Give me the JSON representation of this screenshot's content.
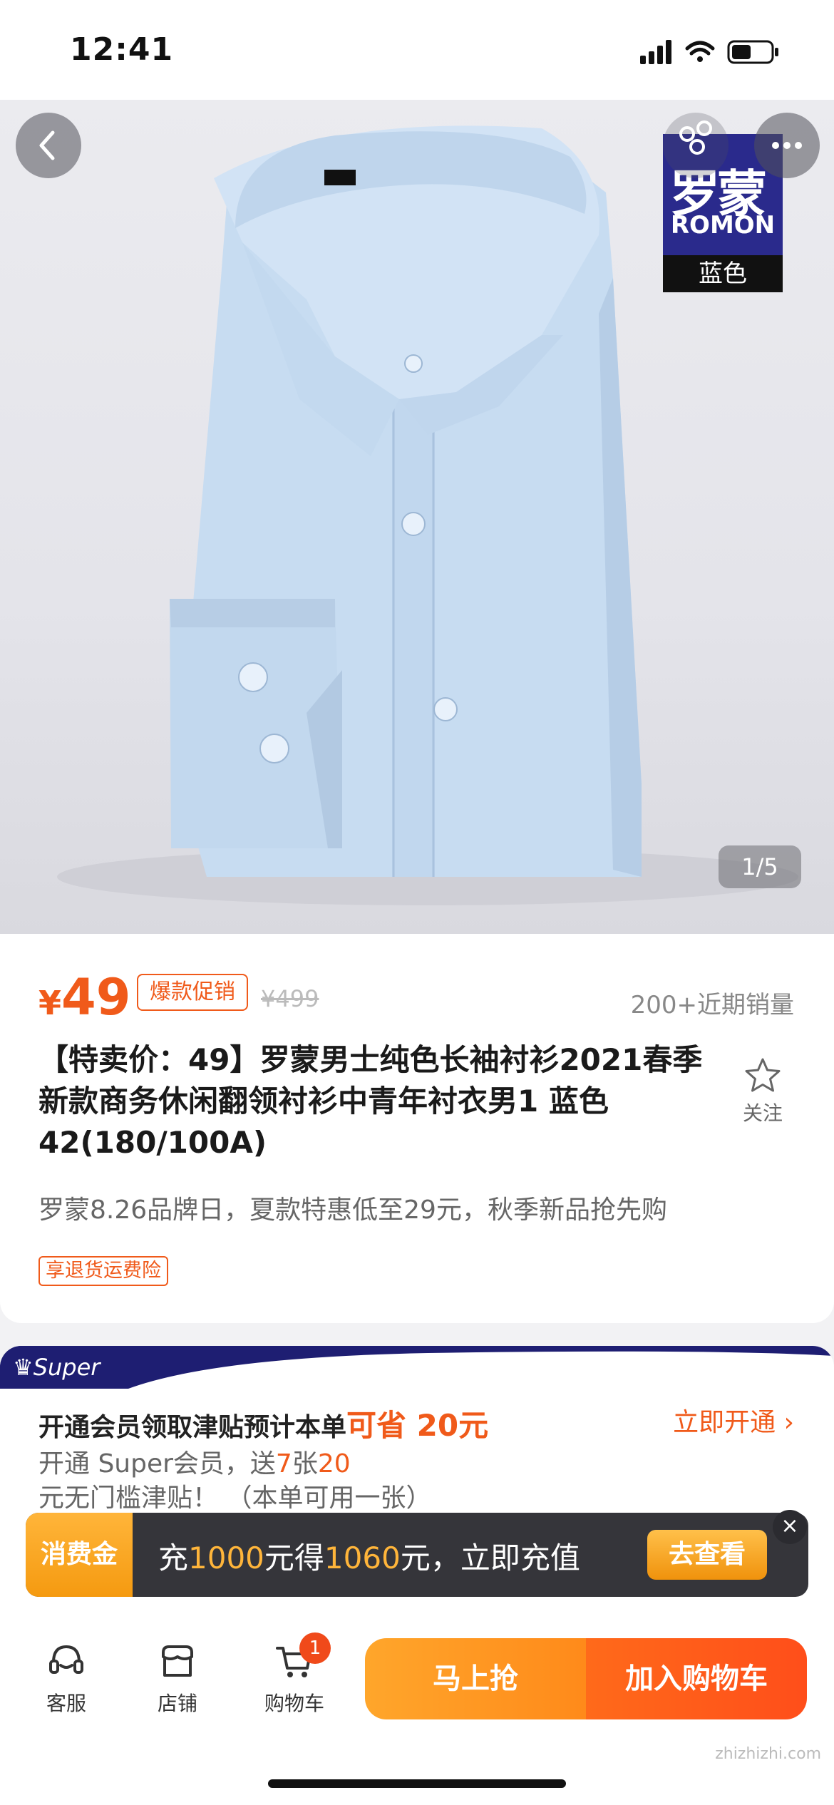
{
  "status_bar": {
    "time": "12:41"
  },
  "hero": {
    "brand_cn": "罗蒙",
    "brand_en": "ROMON",
    "color_label": "蓝色",
    "pager": "1/5"
  },
  "product": {
    "currency": "¥",
    "price": "49",
    "hot_tag": "爆款促销",
    "original_price": "¥499",
    "sales": "200+近期销量",
    "title": "【特卖价：49】罗蒙男士纯色长袖衬衫2021春季新款商务休闲翻领衬衫中青年衬衣男1 蓝色 42(180/100A)",
    "follow_label": "关注",
    "promo_line": "罗蒙8.26品牌日，夏款特惠低至29元，秋季新品抢先购",
    "insurance_tag": "享退货运费险"
  },
  "super": {
    "badge": "Super",
    "title_prefix": "开通会员领取津贴预计本单",
    "title_highlight": "可省 20元",
    "open_label": "立即开通 ›",
    "desc_a": "开通 Super会员，送",
    "desc_count": "7",
    "desc_b": "张",
    "desc_value": "20",
    "desc_c": "元无门槛津贴！ （本单可用一张）"
  },
  "recharge": {
    "tag": "消费金",
    "text_prefix": "充",
    "amount": "1000",
    "text_mid": "元得",
    "gain": "1060",
    "text_suffix": "元，立即充值",
    "button": "去查看",
    "close": "×"
  },
  "bottom_bar": {
    "service": "客服",
    "shop": "店铺",
    "cart": "购物车",
    "cart_count": "1",
    "buy_now": "马上抢",
    "add_cart": "加入购物车"
  },
  "watermark": "zhizhizhi.com",
  "colors": {
    "accent": "#f05a1a",
    "shirt": "#c7dcf1",
    "brand": "#2a2a8c"
  }
}
